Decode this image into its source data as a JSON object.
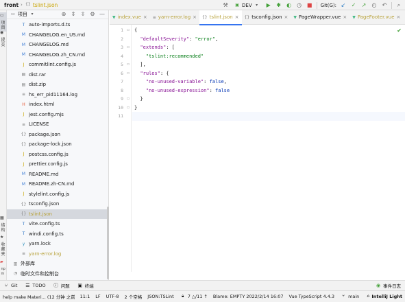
{
  "titlebar": {
    "project": "front",
    "file": "tslint.json",
    "run_config": "DEV",
    "git_label": "Git(G):"
  },
  "left_stripe": {
    "project_tab": "项目",
    "commit_tab": "提交",
    "structure_tab": "结构",
    "bookmarks_tab": "收藏夹",
    "npm_tab": "npm"
  },
  "panel": {
    "title": "项目"
  },
  "tree": [
    {
      "name": "auto-imports.d.ts",
      "icon": "ts-icon",
      "color": "#3178c6",
      "glyph": "T"
    },
    {
      "name": "CHANGELOG.en_US.md",
      "icon": "md-icon",
      "color": "#3a7bd5",
      "glyph": "M"
    },
    {
      "name": "CHANGELOG.md",
      "icon": "md-icon",
      "color": "#3a7bd5",
      "glyph": "M"
    },
    {
      "name": "CHANGELOG.zh_CN.md",
      "icon": "md-icon",
      "color": "#3a7bd5",
      "glyph": "M"
    },
    {
      "name": "commitlint.config.js",
      "icon": "js-icon",
      "color": "#c9a400",
      "glyph": "J"
    },
    {
      "name": "dist.rar",
      "icon": "archive-icon",
      "color": "#777777",
      "glyph": "▤"
    },
    {
      "name": "dist.zip",
      "icon": "archive-icon",
      "color": "#777777",
      "glyph": "▤"
    },
    {
      "name": "hs_err_pid11164.log",
      "icon": "log-icon",
      "color": "#777777",
      "glyph": "≡"
    },
    {
      "name": "index.html",
      "icon": "html-icon",
      "color": "#e44d26",
      "glyph": "H"
    },
    {
      "name": "jest.config.mjs",
      "icon": "js-icon",
      "color": "#c9a400",
      "glyph": "J"
    },
    {
      "name": "LICENSE",
      "icon": "text-icon",
      "color": "#777777",
      "glyph": "≡"
    },
    {
      "name": "package.json",
      "icon": "json-icon",
      "color": "#777777",
      "glyph": "{}"
    },
    {
      "name": "package-lock.json",
      "icon": "json-icon",
      "color": "#777777",
      "glyph": "{}"
    },
    {
      "name": "postcss.config.js",
      "icon": "js-icon",
      "color": "#c9a400",
      "glyph": "J"
    },
    {
      "name": "prettier.config.js",
      "icon": "js-icon",
      "color": "#c9a400",
      "glyph": "J"
    },
    {
      "name": "README.md",
      "icon": "md-icon",
      "color": "#3a7bd5",
      "glyph": "M"
    },
    {
      "name": "README.zh-CN.md",
      "icon": "md-icon",
      "color": "#3a7bd5",
      "glyph": "M"
    },
    {
      "name": "stylelint.config.js",
      "icon": "js-icon",
      "color": "#c9a400",
      "glyph": "J"
    },
    {
      "name": "tsconfig.json",
      "icon": "json-icon",
      "color": "#777777",
      "glyph": "{}"
    },
    {
      "name": "tslint.json",
      "icon": "json-icon",
      "color": "#777777",
      "glyph": "{}",
      "selected": true,
      "ignored": true
    },
    {
      "name": "vite.config.ts",
      "icon": "ts-icon",
      "color": "#3178c6",
      "glyph": "T"
    },
    {
      "name": "windi.config.ts",
      "icon": "ts-icon",
      "color": "#3178c6",
      "glyph": "T"
    },
    {
      "name": "yarn.lock",
      "icon": "lock-icon",
      "color": "#2c8ebb",
      "glyph": "y"
    },
    {
      "name": "yarn-error.log",
      "icon": "log-icon",
      "color": "#777777",
      "glyph": "≡",
      "ignored": true
    },
    {
      "name": "外部库",
      "icon": "library-icon",
      "color": "#777777",
      "glyph": "▥",
      "indent": 0
    },
    {
      "name": "临时文件和控制台",
      "icon": "scratch-icon",
      "color": "#777777",
      "glyph": "◔",
      "indent": 0
    }
  ],
  "tabs": [
    {
      "label": "index.vue",
      "icon": "vue-icon",
      "color": "#41b883",
      "ignored": true
    },
    {
      "label": "yarn-error.log",
      "icon": "log-icon",
      "color": "#777777",
      "ignored": true
    },
    {
      "label": "tslint.json",
      "icon": "json-icon",
      "color": "#777777",
      "active": true,
      "ignored": true
    },
    {
      "label": "tsconfig.json",
      "icon": "json-icon",
      "color": "#777777"
    },
    {
      "label": "PageWrapper.vue",
      "icon": "vue-icon",
      "color": "#41b883"
    },
    {
      "label": "PageFooter.vue",
      "icon": "vue-icon",
      "color": "#41b883",
      "ignored": true
    },
    {
      "label": "sr",
      "icon": "vue-icon",
      "color": "#41b883"
    }
  ],
  "editor": {
    "line_numbers": [
      "1",
      "2",
      "3",
      "4",
      "5",
      "6",
      "7",
      "8",
      "9",
      "10",
      "11"
    ],
    "lines": [
      [
        {
          "t": "{",
          "c": "p"
        }
      ],
      [
        {
          "t": "  ",
          "c": "p"
        },
        {
          "t": "\"defaultSeverity\"",
          "c": "k"
        },
        {
          "t": ": ",
          "c": "p"
        },
        {
          "t": "\"error\"",
          "c": "s"
        },
        {
          "t": ",",
          "c": "p"
        }
      ],
      [
        {
          "t": "  ",
          "c": "p"
        },
        {
          "t": "\"extends\"",
          "c": "k"
        },
        {
          "t": ": [",
          "c": "p"
        }
      ],
      [
        {
          "t": "    ",
          "c": "p"
        },
        {
          "t": "\"tslint:recommended\"",
          "c": "s"
        }
      ],
      [
        {
          "t": "  ],",
          "c": "p"
        }
      ],
      [
        {
          "t": "  ",
          "c": "p"
        },
        {
          "t": "\"rules\"",
          "c": "k"
        },
        {
          "t": ": {",
          "c": "p"
        }
      ],
      [
        {
          "t": "    ",
          "c": "p"
        },
        {
          "t": "\"no-unused-variable\"",
          "c": "k"
        },
        {
          "t": ": ",
          "c": "p"
        },
        {
          "t": "false",
          "c": "b"
        },
        {
          "t": ",",
          "c": "p"
        }
      ],
      [
        {
          "t": "    ",
          "c": "p"
        },
        {
          "t": "\"no-unused-expression\"",
          "c": "k"
        },
        {
          "t": ": ",
          "c": "p"
        },
        {
          "t": "false",
          "c": "b"
        }
      ],
      [
        {
          "t": "  }",
          "c": "p"
        }
      ],
      [
        {
          "t": "}",
          "c": "p"
        }
      ],
      [
        {
          "t": "",
          "c": "p"
        }
      ]
    ]
  },
  "bottom_tools": {
    "git": "Git",
    "todo": "TODO",
    "problems": "问题",
    "terminal": "终端",
    "events": "事件日志"
  },
  "status": {
    "message": "help make Materi... (12 分钟 之前)",
    "position": "11:1",
    "line_sep": "LF",
    "encoding": "UTF-8",
    "indent": "2 个空格",
    "schema": "JSON:TSLint",
    "checks": "7 △/11 ↑",
    "blame": "Blame: EMPTY 2022/2/14 16:07",
    "vue_ts": "Vue TypeScript 4.4.3",
    "branch": "main",
    "theme": "IntelliJ Light"
  },
  "colors": {
    "accent": "#3574f0",
    "ignored_file": "#b8a23a",
    "run_green": "#45a13a"
  }
}
